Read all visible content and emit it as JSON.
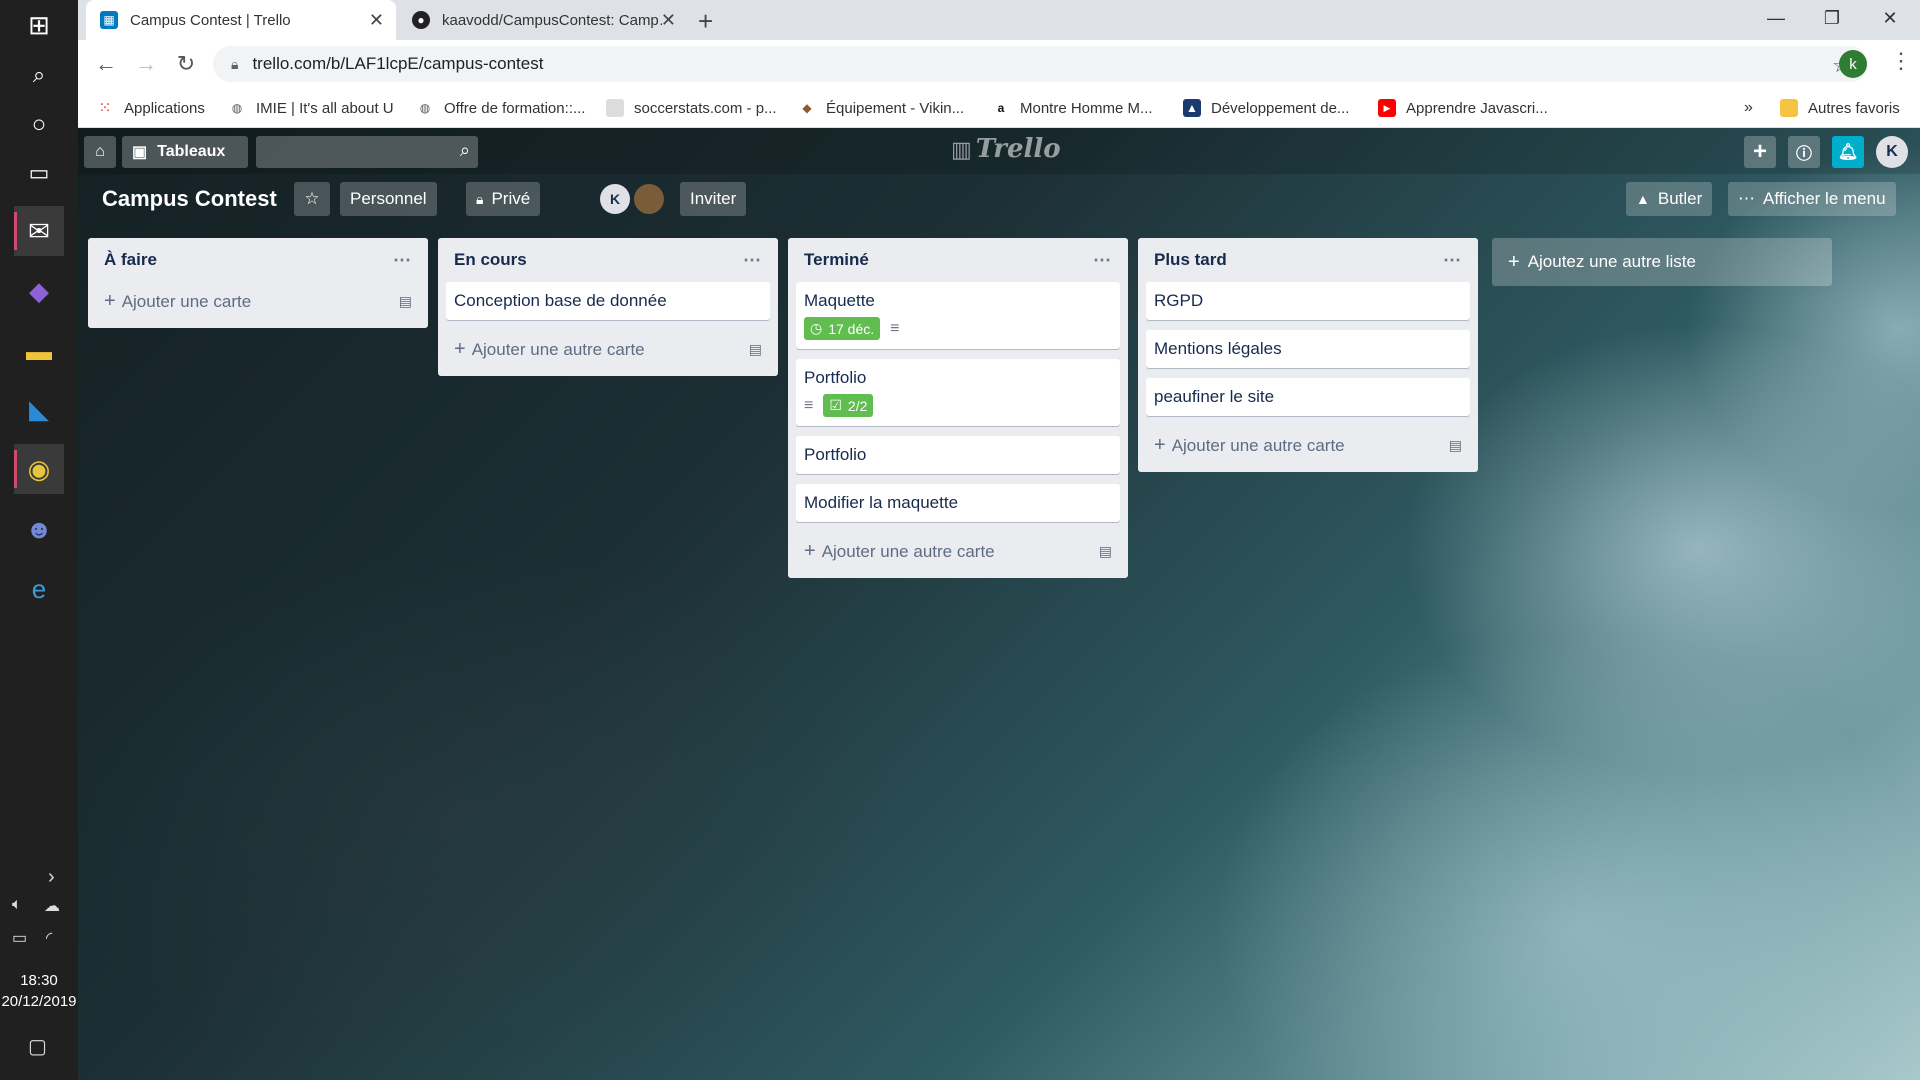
{
  "taskbar": {
    "icons": [
      "windows-icon",
      "search-icon",
      "cortana-icon",
      "task-view-icon",
      "mail-icon",
      "visual-studio-icon",
      "file-explorer-icon",
      "vscode-icon",
      "chrome-icon",
      "discord-icon",
      "edge-icon"
    ],
    "time": "18:30",
    "date": "20/12/2019"
  },
  "browser": {
    "tabs": [
      {
        "title": "Campus Contest | Trello",
        "active": true
      },
      {
        "title": "kaavodd/CampusContest: Camp…",
        "active": false
      }
    ],
    "url": "trello.com/b/LAF1lcpE/campus-contest",
    "profile_initial": "k",
    "bookmarks": [
      "Applications",
      "IMIE | It's all about U",
      "Offre de formation::...",
      "soccerstats.com - p...",
      "Équipement - Vikin...",
      "Montre Homme M...",
      "Développement de...",
      "Apprendre Javascri..."
    ],
    "other_bookmarks": "Autres favoris",
    "overflow": "»"
  },
  "board": {
    "header": {
      "boards_label": "Tableaux",
      "logo": "Trello",
      "user_initial": "K"
    },
    "title": "Campus Contest",
    "personal_label": "Personnel",
    "private_label": "Privé",
    "member_initial": "K",
    "invite_label": "Inviter",
    "butler_label": "Butler",
    "menu_label": "Afficher le menu",
    "add_list_label": "Ajoutez une autre liste",
    "lists": [
      {
        "title": "À faire",
        "cards": [],
        "add_label": "Ajouter une carte"
      },
      {
        "title": "En cours",
        "cards": [
          {
            "title": "Conception base de donnée"
          }
        ],
        "add_label": "Ajouter une autre carte"
      },
      {
        "title": "Terminé",
        "cards": [
          {
            "title": "Maquette",
            "due": "17 déc."
          },
          {
            "title": "Portfolio",
            "checklist": "2/2"
          },
          {
            "title": "Portfolio"
          },
          {
            "title": "Modifier la maquette"
          }
        ],
        "add_label": "Ajouter une autre carte"
      },
      {
        "title": "Plus tard",
        "cards": [
          {
            "title": "RGPD"
          },
          {
            "title": "Mentions légales"
          },
          {
            "title": "peaufiner le site"
          }
        ],
        "add_label": "Ajouter une autre carte"
      }
    ]
  },
  "colors": {
    "accent_green": "#61bd4f",
    "notification_blue": "#00aecc",
    "list_bg": "#ebecf0"
  }
}
